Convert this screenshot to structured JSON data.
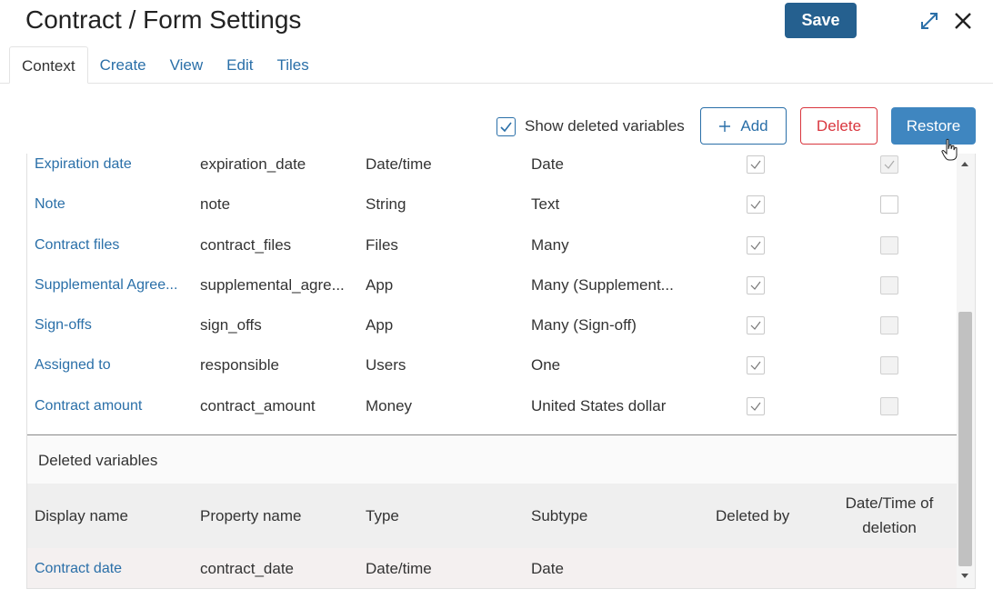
{
  "header": {
    "title": "Contract / Form Settings",
    "save_label": "Save"
  },
  "tabs": [
    {
      "label": "Context",
      "active": true
    },
    {
      "label": "Create",
      "active": false
    },
    {
      "label": "View",
      "active": false
    },
    {
      "label": "Edit",
      "active": false
    },
    {
      "label": "Tiles",
      "active": false
    }
  ],
  "toolbar": {
    "show_deleted_label": "Show deleted variables",
    "show_deleted_checked": true,
    "add_label": "Add",
    "delete_label": "Delete",
    "restore_label": "Restore"
  },
  "variables": [
    {
      "display_name": "Expiration date",
      "property": "expiration_date",
      "type": "Date/time",
      "subtype": "Date",
      "check1": true,
      "check2": true,
      "check2_disabled": true
    },
    {
      "display_name": "Note",
      "property": "note",
      "type": "String",
      "subtype": "Text",
      "check1": true,
      "check2": false,
      "check2_disabled": false
    },
    {
      "display_name": "Contract files",
      "property": "contract_files",
      "type": "Files",
      "subtype": "Many",
      "check1": true,
      "check2": false,
      "check2_disabled": true
    },
    {
      "display_name": "Supplemental Agree...",
      "property": "supplemental_agre...",
      "type": "App",
      "subtype": "Many (Supplement...",
      "check1": true,
      "check2": false,
      "check2_disabled": true
    },
    {
      "display_name": "Sign-offs",
      "property": "sign_offs",
      "type": "App",
      "subtype": "Many (Sign-off)",
      "check1": true,
      "check2": false,
      "check2_disabled": true
    },
    {
      "display_name": "Assigned to",
      "property": "responsible",
      "type": "Users",
      "subtype": "One",
      "check1": true,
      "check2": false,
      "check2_disabled": true
    },
    {
      "display_name": "Contract amount",
      "property": "contract_amount",
      "type": "Money",
      "subtype": "United States dollar",
      "check1": true,
      "check2": false,
      "check2_disabled": true
    }
  ],
  "deleted": {
    "title": "Deleted variables",
    "headers": {
      "display_name": "Display name",
      "property": "Property name",
      "type": "Type",
      "subtype": "Subtype",
      "deleted_by": "Deleted by",
      "deleted_at_line1": "Date/Time of",
      "deleted_at_line2": "deletion"
    },
    "rows": [
      {
        "display_name": "Contract date",
        "property": "contract_date",
        "type": "Date/time",
        "subtype": "Date"
      }
    ]
  },
  "colors": {
    "primary": "#25608f",
    "link": "#2a6fa8",
    "danger": "#d9363e",
    "restore": "#3f86c0"
  }
}
